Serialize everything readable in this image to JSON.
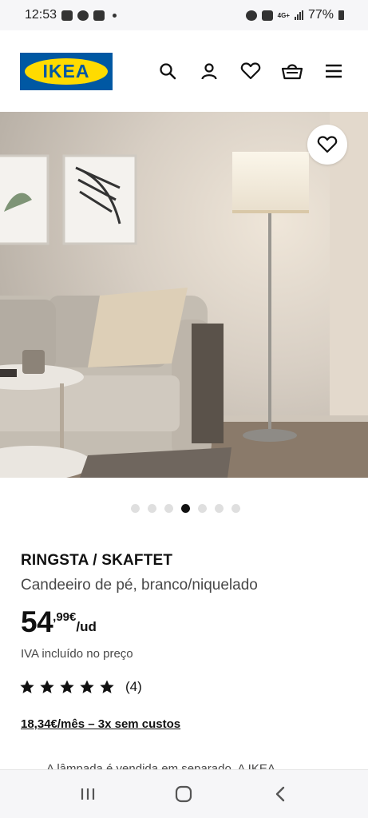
{
  "status_bar": {
    "time": "12:53",
    "network": "4G+",
    "battery": "77%"
  },
  "header": {
    "logo_text": "IKEA",
    "icons": [
      "search-icon",
      "account-icon",
      "wishlist-heart-icon",
      "shopping-basket-icon",
      "menu-icon"
    ]
  },
  "gallery": {
    "total_images": 7,
    "active_index": 4,
    "favorite_icon": "heart-icon"
  },
  "product": {
    "name": "RINGSTA / SKAFTET",
    "description": "Candeeiro de pé, branco/niquelado",
    "price_integer": "54",
    "price_decimal": ",99€",
    "price_unit": "/ud",
    "vat_note": "IVA incluído no preço",
    "rating_stars": 5,
    "rating_count": "(4)",
    "installments": "18,34€/mês – 3x sem custos",
    "partial_text": "A lâmpada é vendida em separado. A IKEA"
  },
  "nav_bar": {
    "buttons": [
      "recent-apps",
      "home",
      "back"
    ]
  },
  "colors": {
    "ikea_blue": "#0058a3",
    "ikea_yellow": "#ffdb00",
    "text_dark": "#111111",
    "text_muted": "#484848"
  }
}
